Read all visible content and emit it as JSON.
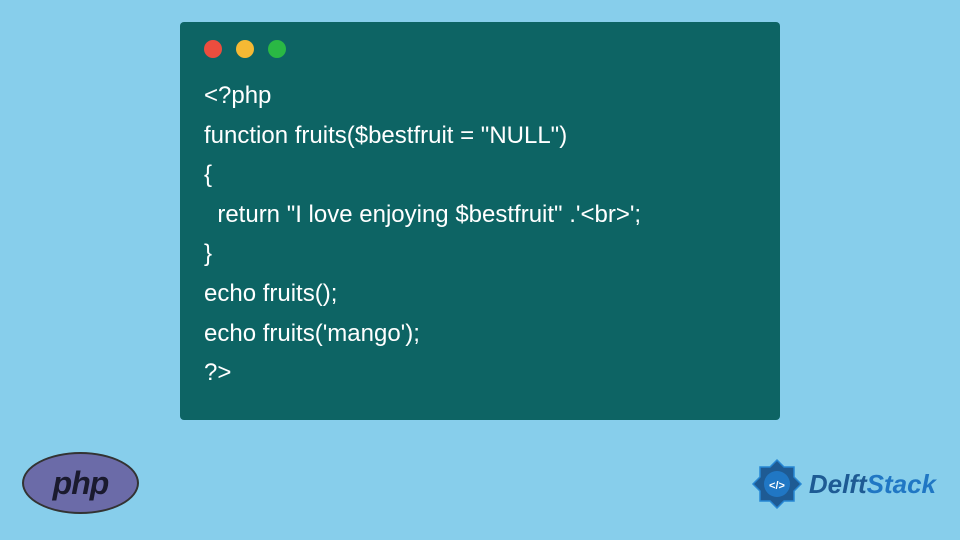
{
  "code": {
    "line1": "<?php",
    "line2": "function fruits($bestfruit = \"NULL\")",
    "line3": "{",
    "line4": "  return \"I love enjoying $bestfruit\" .'<br>';",
    "line5": "}",
    "line6": "echo fruits();",
    "line7": "echo fruits('mango');",
    "line8": "?>"
  },
  "logos": {
    "php": "php",
    "delft_d": "D",
    "delft_elft": "elft",
    "delft_stack": "Stack"
  },
  "window_controls": {
    "red": "#ec4d3e",
    "yellow": "#f5b934",
    "green": "#2ab844"
  }
}
